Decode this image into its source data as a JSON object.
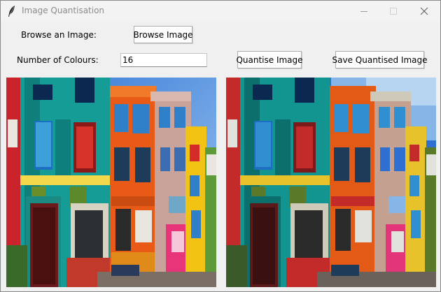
{
  "window": {
    "title": "Image Quantisation",
    "controls": {
      "minimize_icon": "minimize-icon",
      "maximize_icon": "maximize-icon",
      "close_icon": "close-icon"
    }
  },
  "form": {
    "browse_label": "Browse an Image:",
    "browse_button": "Browse Image",
    "colours_label": "Number of Colours:",
    "colours_value": "16",
    "quantise_button": "Quantise Image",
    "save_button": "Save Quantised Image"
  },
  "images": {
    "original": {
      "name": "original-image",
      "content": "colourful row of houses street photo"
    },
    "quantised": {
      "name": "quantised-image",
      "content": "same photo reduced to 16 colours"
    }
  }
}
